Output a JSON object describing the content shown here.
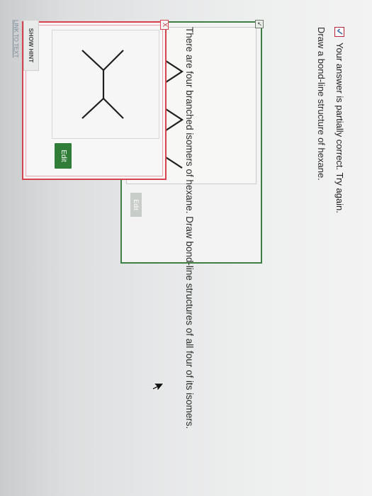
{
  "feedback": {
    "text": "Your answer is partially correct.  Try again.",
    "status_color": "#b8243a"
  },
  "question_1": {
    "text": "Draw a bond-line structure of hexane."
  },
  "answer_panel": {
    "edit_label": "Edit",
    "corner_label": "↙"
  },
  "question_2": {
    "text": "There are four branched isomers of hexane. Draw bond-line structures of all four of its isomers."
  },
  "isomer_panel": {
    "edit_label": "Edit",
    "remove_label": "X"
  },
  "hint": {
    "label": "SHOW HINT"
  },
  "link": {
    "label": "LINK TO TEXT"
  },
  "colors": {
    "accent_green": "#2f7d36",
    "error_red": "#d6434e"
  },
  "icons": [
    "checkmark-icon",
    "remove-icon",
    "mouse-cursor-icon"
  ]
}
